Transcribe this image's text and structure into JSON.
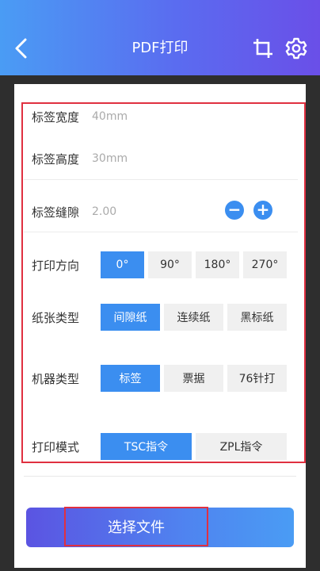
{
  "header": {
    "title": "PDF打印",
    "back_icon": "chevron-left-icon",
    "crop_icon": "crop-icon",
    "settings_icon": "gear-icon"
  },
  "form": {
    "label_width": {
      "label": "标签宽度",
      "value": "40mm"
    },
    "label_height": {
      "label": "标签高度",
      "value": "30mm"
    },
    "label_gap": {
      "label": "标签缝隙",
      "value": "2.00",
      "minus": "−",
      "plus": "+"
    },
    "print_direction": {
      "label": "打印方向",
      "options": [
        "0°",
        "90°",
        "180°",
        "270°"
      ],
      "selected": "0°"
    },
    "paper_type": {
      "label": "纸张类型",
      "options": [
        "间隙纸",
        "连续纸",
        "黑标纸"
      ],
      "selected": "间隙纸"
    },
    "machine_type": {
      "label": "机器类型",
      "options": [
        "标签",
        "票据",
        "76针打"
      ],
      "selected": "标签"
    },
    "print_mode": {
      "label": "打印模式",
      "options": [
        "TSC指令",
        "ZPL指令"
      ],
      "selected": "TSC指令"
    }
  },
  "actions": {
    "select_file": "选择文件"
  },
  "colors": {
    "accent": "#3b8ef0",
    "header_start": "#4a9cf4",
    "header_end": "#6a4fe8",
    "highlight": "#e03040"
  }
}
